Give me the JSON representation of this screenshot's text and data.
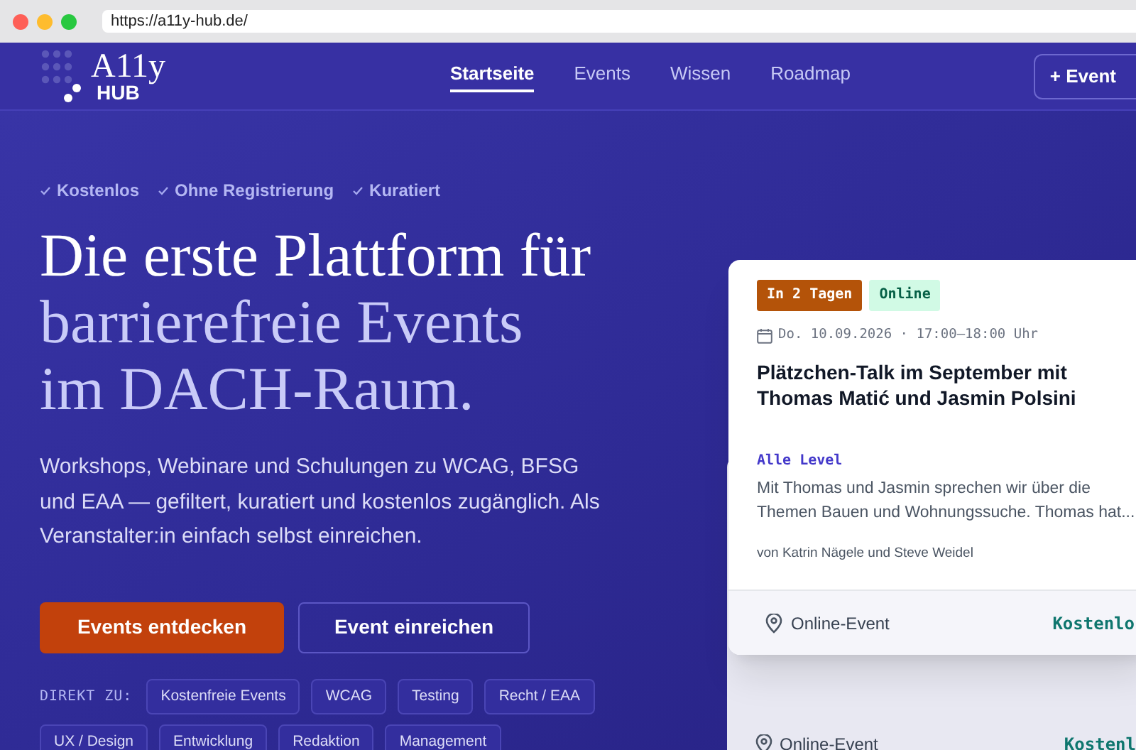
{
  "browser": {
    "url": "https://a11y-hub.de/"
  },
  "header": {
    "logo": {
      "word": "A11y",
      "sub": "HUB"
    },
    "nav": [
      {
        "label": "Startseite",
        "selected": true
      },
      {
        "label": "Events",
        "selected": false
      },
      {
        "label": "Wissen",
        "selected": false
      },
      {
        "label": "Roadmap",
        "selected": false
      }
    ],
    "cta": "+ Event"
  },
  "hero": {
    "checks": [
      "Kostenlos",
      "Ohne Registrierung",
      "Kuratiert"
    ],
    "heading": [
      {
        "text": "Die erste Plattform für",
        "highlighted": false
      },
      {
        "text": "barrierefreie Events",
        "highlighted": true
      },
      {
        "text": "im DACH-Raum.",
        "highlighted": true
      }
    ],
    "intro": "Workshops, Webinare und Schulungen zu WCAG, BFSG und EAA — gefiltert, kuratiert und kostenlos zugänglich. Als Veranstalter:in einfach selbst einreichen.",
    "buttons": [
      {
        "label": "Events entdecken",
        "kind": "primary"
      },
      {
        "label": "Event einreichen",
        "kind": "secondary"
      }
    ],
    "quick_label": "DIREKT ZU:",
    "quick_links": [
      "Kostenfreie Events",
      "WCAG",
      "Testing",
      "Recht / EAA",
      "UX / Design",
      "Entwicklung",
      "Redaktion",
      "Management"
    ]
  },
  "event_card": {
    "badges": [
      {
        "label": "In 2 Tagen",
        "kind": "soon"
      },
      {
        "label": "Online",
        "kind": "format"
      }
    ],
    "date": "Do. 10.09.2026 · 17:00–18:00 Uhr",
    "title": "Plätzchen-Talk im September mit Thomas Matić und Jasmin Polsini",
    "level": "Alle Level",
    "description": "Mit Thomas und Jasmin sprechen wir über die Themen Bauen und Wohnungssuche. Thomas hat...",
    "hosts": "von Katrin Nägele und Steve Weidel",
    "location": "Online-Event",
    "price": "Kostenlo"
  },
  "back_card": {
    "location": "Online-Event",
    "price": "Kostenl"
  }
}
